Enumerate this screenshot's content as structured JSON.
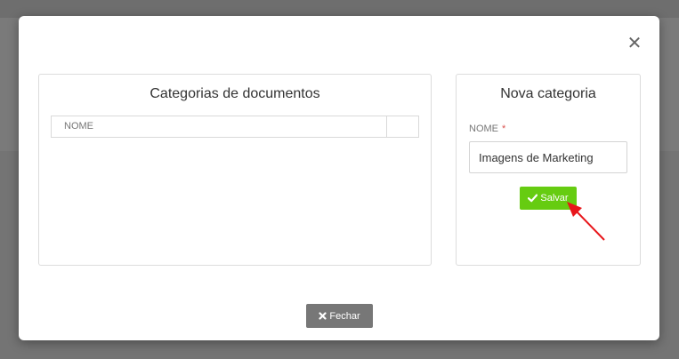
{
  "modal": {
    "close_icon": "close-icon",
    "categories_panel": {
      "title": "Categorias de documentos",
      "table_headers": [
        "NOME",
        ""
      ]
    },
    "new_category_panel": {
      "title": "Nova categoria",
      "field_label": "NOME",
      "required_mark": "*",
      "field_value": "Imagens de Marketing",
      "save_label": "Salvar",
      "save_icon": "check-icon"
    },
    "close_button_label": "Fechar",
    "close_button_icon": "times-icon"
  },
  "colors": {
    "save_button": "#66cc11",
    "close_button": "#777777",
    "required_mark": "#d9534f",
    "annotation_arrow": "#e8161b"
  }
}
